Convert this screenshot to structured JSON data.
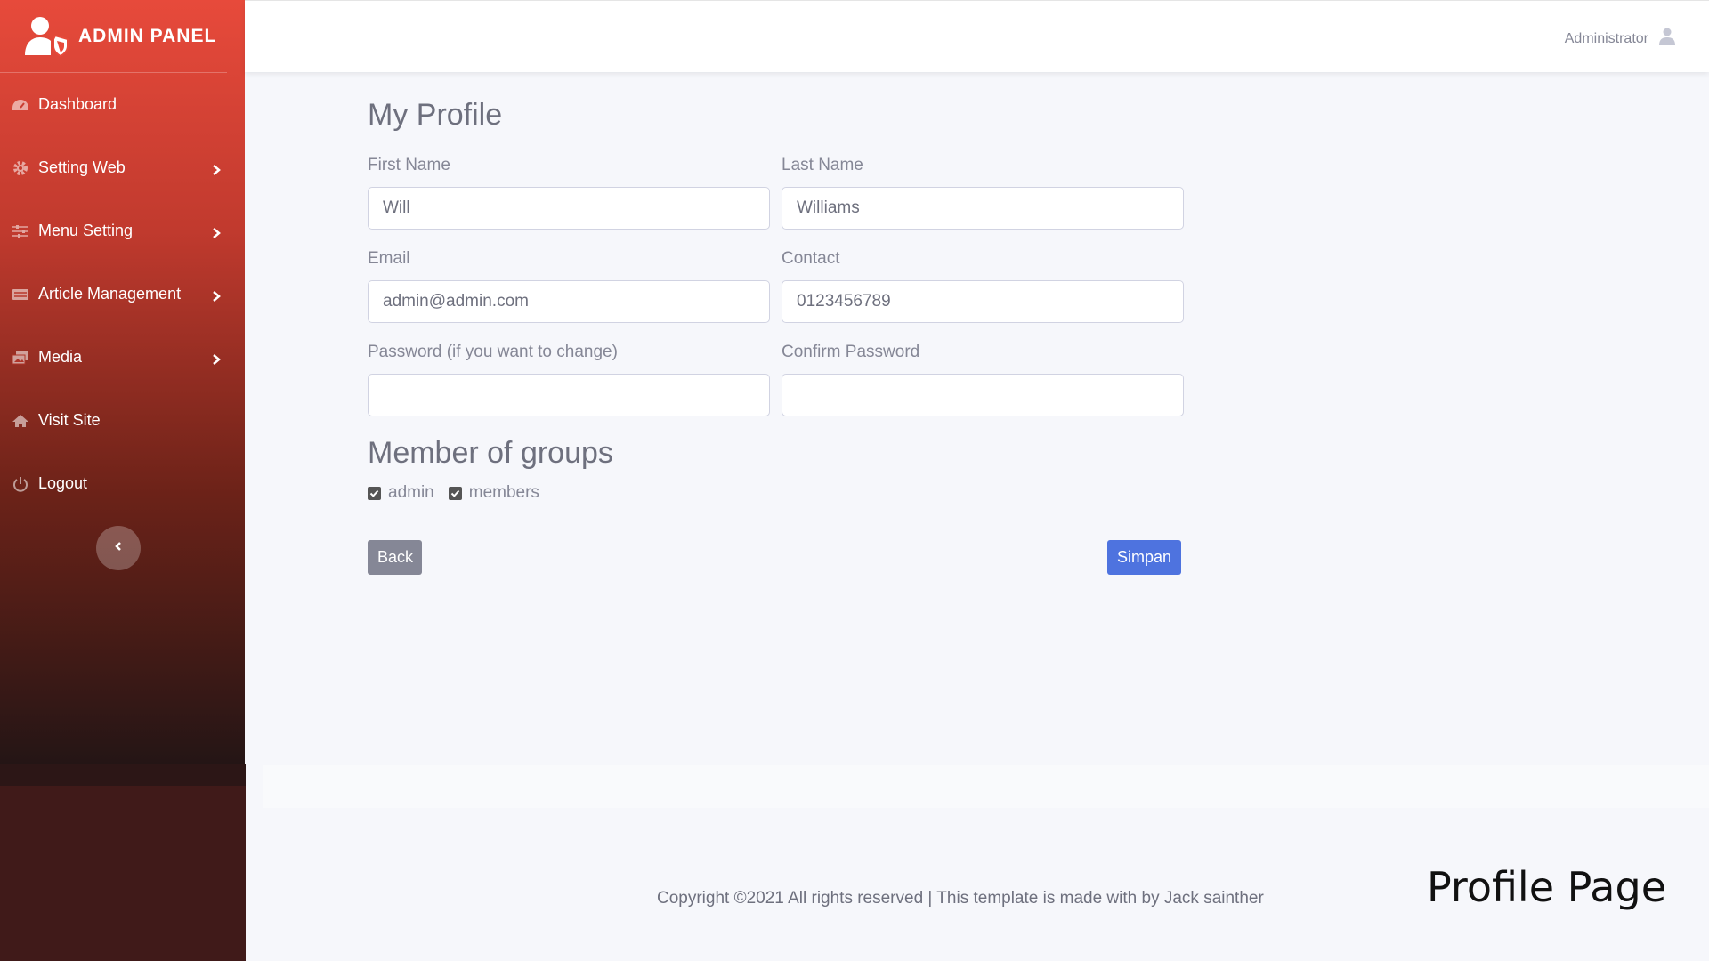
{
  "brand": {
    "title": "ADMIN PANEL"
  },
  "sidebar": {
    "items": [
      {
        "label": "Dashboard",
        "icon": "dashboard-icon",
        "has_submenu": false
      },
      {
        "label": "Setting Web",
        "icon": "gear-icon",
        "has_submenu": true
      },
      {
        "label": "Menu Setting",
        "icon": "sliders-icon",
        "has_submenu": true
      },
      {
        "label": "Article Management",
        "icon": "article-icon",
        "has_submenu": true
      },
      {
        "label": "Media",
        "icon": "images-icon",
        "has_submenu": true
      },
      {
        "label": "Visit Site",
        "icon": "home-icon",
        "has_submenu": false
      },
      {
        "label": "Logout",
        "icon": "power-icon",
        "has_submenu": false
      }
    ]
  },
  "topbar": {
    "username": "Administrator"
  },
  "profile": {
    "title": "My Profile",
    "first_name": {
      "label": "First Name",
      "value": "Will"
    },
    "last_name": {
      "label": "Last Name",
      "value": "Williams"
    },
    "email": {
      "label": "Email",
      "value": "admin@admin.com"
    },
    "contact": {
      "label": "Contact",
      "value": "0123456789"
    },
    "password": {
      "label": "Password (if you want to change)",
      "value": ""
    },
    "confirm_password": {
      "label": "Confirm Password",
      "value": ""
    },
    "groups_title": "Member of groups",
    "groups": [
      {
        "label": "admin",
        "checked": true
      },
      {
        "label": "members",
        "checked": true
      }
    ],
    "back_label": "Back",
    "save_label": "Simpan"
  },
  "footer": {
    "text": "Copyright ©2021 All rights reserved | This template is made with  by Jack sainther"
  },
  "caption": "Profile Page",
  "colors": {
    "sidebar_top": "#e74a3b",
    "primary": "#4e73df",
    "secondary": "#858796"
  }
}
